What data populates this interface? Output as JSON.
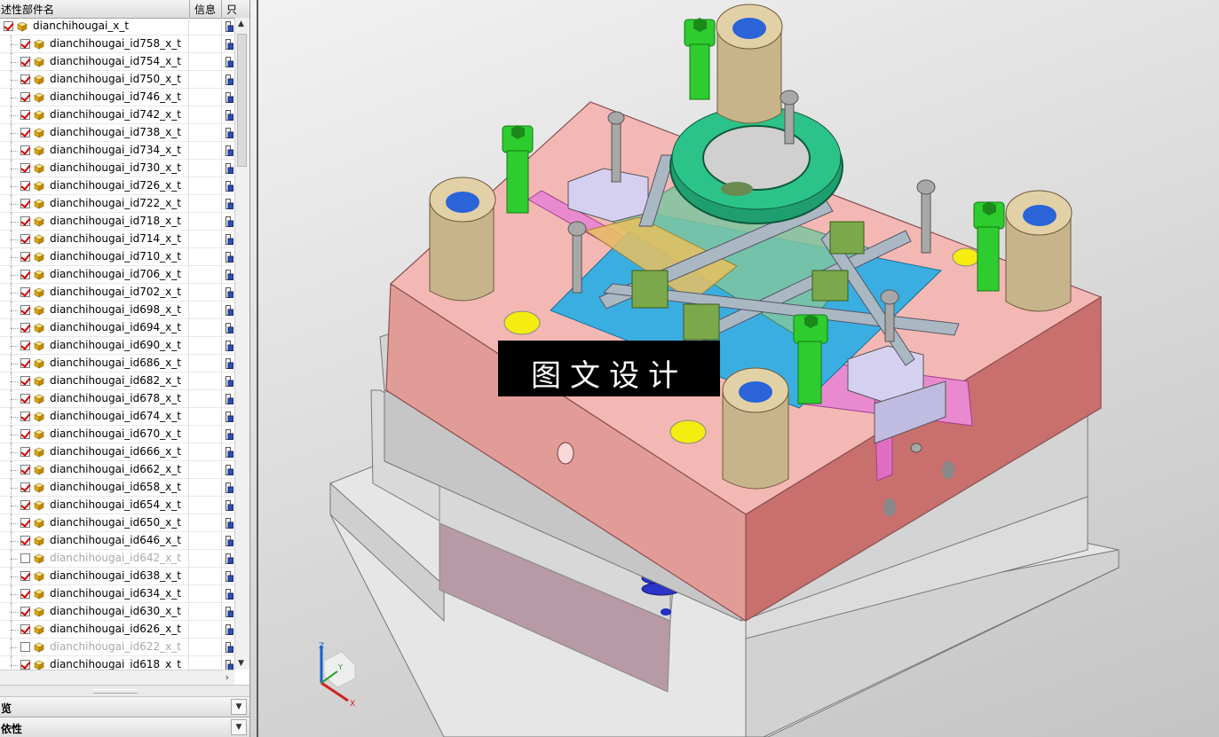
{
  "navigator": {
    "columns": {
      "name": "述性部件名",
      "info": "信息",
      "readonly": "只"
    },
    "root": {
      "label": "dianchihougai_x_t",
      "checked": true
    },
    "items": [
      {
        "label": "dianchihougai_id758_x_t",
        "checked": true
      },
      {
        "label": "dianchihougai_id754_x_t",
        "checked": true
      },
      {
        "label": "dianchihougai_id750_x_t",
        "checked": true
      },
      {
        "label": "dianchihougai_id746_x_t",
        "checked": true
      },
      {
        "label": "dianchihougai_id742_x_t",
        "checked": true
      },
      {
        "label": "dianchihougai_id738_x_t",
        "checked": true
      },
      {
        "label": "dianchihougai_id734_x_t",
        "checked": true
      },
      {
        "label": "dianchihougai_id730_x_t",
        "checked": true
      },
      {
        "label": "dianchihougai_id726_x_t",
        "checked": true
      },
      {
        "label": "dianchihougai_id722_x_t",
        "checked": true
      },
      {
        "label": "dianchihougai_id718_x_t",
        "checked": true
      },
      {
        "label": "dianchihougai_id714_x_t",
        "checked": true
      },
      {
        "label": "dianchihougai_id710_x_t",
        "checked": true
      },
      {
        "label": "dianchihougai_id706_x_t",
        "checked": true
      },
      {
        "label": "dianchihougai_id702_x_t",
        "checked": true
      },
      {
        "label": "dianchihougai_id698_x_t",
        "checked": true
      },
      {
        "label": "dianchihougai_id694_x_t",
        "checked": true
      },
      {
        "label": "dianchihougai_id690_x_t",
        "checked": true
      },
      {
        "label": "dianchihougai_id686_x_t",
        "checked": true
      },
      {
        "label": "dianchihougai_id682_x_t",
        "checked": true
      },
      {
        "label": "dianchihougai_id678_x_t",
        "checked": true
      },
      {
        "label": "dianchihougai_id674_x_t",
        "checked": true
      },
      {
        "label": "dianchihougai_id670_x_t",
        "checked": true
      },
      {
        "label": "dianchihougai_id666_x_t",
        "checked": true
      },
      {
        "label": "dianchihougai_id662_x_t",
        "checked": true
      },
      {
        "label": "dianchihougai_id658_x_t",
        "checked": true
      },
      {
        "label": "dianchihougai_id654_x_t",
        "checked": true
      },
      {
        "label": "dianchihougai_id650_x_t",
        "checked": true
      },
      {
        "label": "dianchihougai_id646_x_t",
        "checked": true
      },
      {
        "label": "dianchihougai_id642_x_t",
        "checked": false
      },
      {
        "label": "dianchihougai_id638_x_t",
        "checked": true
      },
      {
        "label": "dianchihougai_id634_x_t",
        "checked": true
      },
      {
        "label": "dianchihougai_id630_x_t",
        "checked": true
      },
      {
        "label": "dianchihougai_id626_x_t",
        "checked": true
      },
      {
        "label": "dianchihougai_id622_x_t",
        "checked": false
      },
      {
        "label": "dianchihougai_id618_x_t",
        "checked": true
      }
    ]
  },
  "panels": {
    "preview": "览",
    "dependencies": "依性"
  },
  "viewport": {
    "watermark": "图文设计",
    "triad": {
      "x": "X",
      "y": "Y",
      "z": "Z"
    }
  },
  "colors": {
    "check": "#d00000",
    "plate_pink": "#f2b4b0",
    "plate_red": "#c96f6e",
    "cavity_blue": "#3aaee0",
    "green_parts": "#2ecc2e",
    "bushing": "#d6c49a"
  }
}
